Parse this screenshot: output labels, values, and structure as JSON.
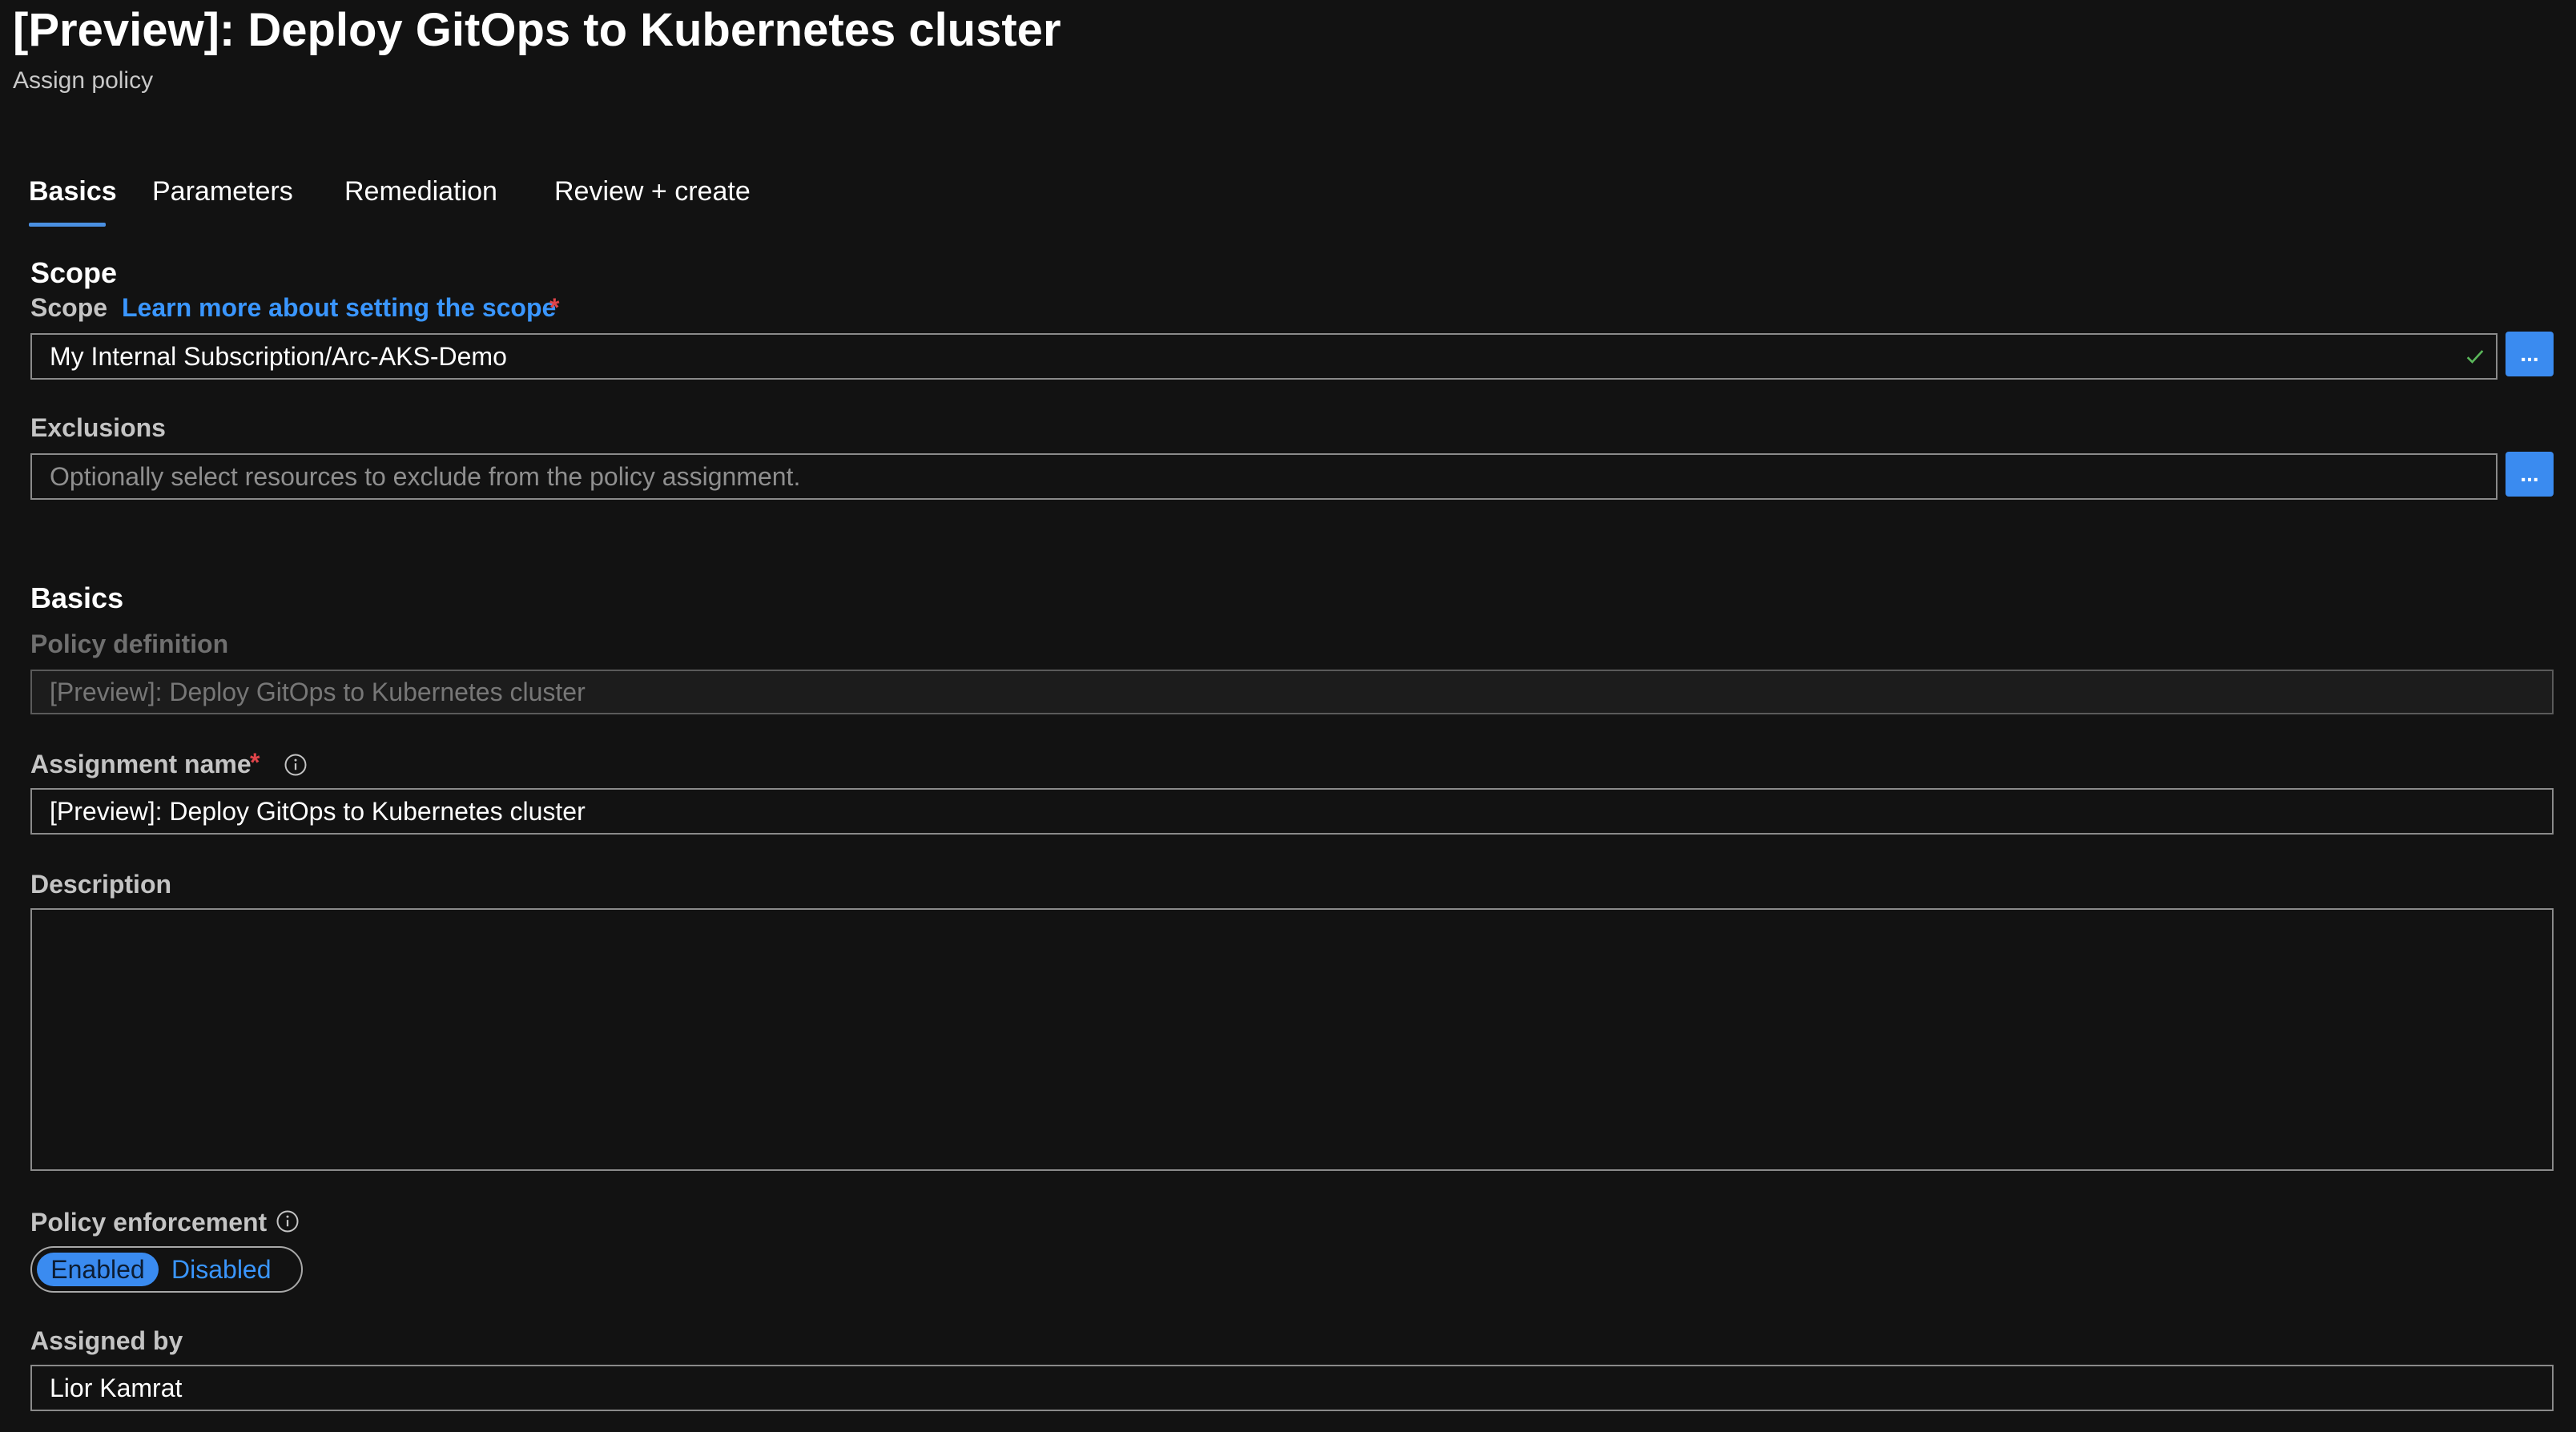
{
  "header": {
    "title": "[Preview]: Deploy GitOps to Kubernetes cluster",
    "subtitle": "Assign policy"
  },
  "tabs": [
    {
      "label": "Basics",
      "active": true
    },
    {
      "label": "Parameters",
      "active": false
    },
    {
      "label": "Remediation",
      "active": false
    },
    {
      "label": "Review + create",
      "active": false
    }
  ],
  "scope_section": {
    "title": "Scope",
    "scope_label": "Scope",
    "learn_more_link": "Learn more about setting the scope",
    "required_marker": "*",
    "scope_value": "My Internal Subscription/Arc-AKS-Demo",
    "browse_label": "...",
    "exclusions_label": "Exclusions",
    "exclusions_placeholder": "Optionally select resources to exclude from the policy assignment.",
    "exclusions_browse_label": "..."
  },
  "basics_section": {
    "title": "Basics",
    "policy_definition_label": "Policy definition",
    "policy_definition_value": "[Preview]: Deploy GitOps to Kubernetes cluster",
    "assignment_name_label": "Assignment name",
    "assignment_name_required": "*",
    "assignment_name_value": "[Preview]: Deploy GitOps to Kubernetes cluster",
    "description_label": "Description",
    "description_value": "",
    "policy_enforcement_label": "Policy enforcement",
    "enforcement_options": [
      "Enabled",
      "Disabled"
    ],
    "enforcement_selected": "Enabled",
    "assigned_by_label": "Assigned by",
    "assigned_by_value": "Lior Kamrat"
  },
  "colors": {
    "background": "#121212",
    "accent": "#3a8bf0",
    "link": "#3a96ff",
    "required": "#e0444a",
    "valid": "#5bb85b"
  },
  "icons": {
    "scope_valid": "check-icon",
    "assignment_info": "info-icon",
    "enforcement_info": "info-icon"
  }
}
